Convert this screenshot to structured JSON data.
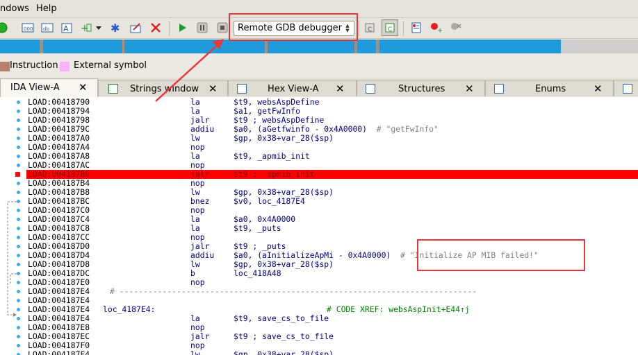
{
  "menu": {
    "items": [
      "ndows",
      "Help"
    ]
  },
  "toolbar": {
    "debugger_select": "Remote GDB debugger",
    "icons": [
      "green-circle-icon",
      "code-icon",
      "data-icon",
      "string-icon",
      "struct-plus-icon",
      "dropdown-arrow-icon",
      "enum-icon",
      "patch-icon",
      "stop-red-x-icon",
      "play-icon",
      "pause-icon",
      "stop-icon",
      "attach-icon",
      "step-into-icon",
      "breakpoint-list-icon",
      "add-breakpoint-icon",
      "detach-icon"
    ]
  },
  "legend": [
    {
      "label": "Instruction",
      "color": "#b8806a"
    },
    {
      "label": "External symbol",
      "color": "#ffb0ff"
    }
  ],
  "tabs": [
    {
      "label": "IDA View-A",
      "active": true
    },
    {
      "label": "Strings window",
      "active": false
    },
    {
      "label": "Hex View-A",
      "active": false
    },
    {
      "label": "Structures",
      "active": false
    },
    {
      "label": "Enums",
      "active": false
    }
  ],
  "disasm": [
    {
      "addr": "LOAD:00418790",
      "mn": "la",
      "op": "$t9, websAspDefine",
      "comment": ""
    },
    {
      "addr": "LOAD:00418794",
      "mn": "la",
      "op": "$a1, getFwInfo",
      "comment": ""
    },
    {
      "addr": "LOAD:00418798",
      "mn": "jalr",
      "op": "$t9 ; websAspDefine",
      "comment": ""
    },
    {
      "addr": "LOAD:0041879C",
      "mn": "addiu",
      "op": "$a0, (aGetfwinfo - 0x4A0000)",
      "comment": "# \"getFwInfo\""
    },
    {
      "addr": "LOAD:004187A0",
      "mn": "lw",
      "op": "$gp, 0x38+var_28($sp)",
      "comment": ""
    },
    {
      "addr": "LOAD:004187A4",
      "mn": "nop",
      "op": "",
      "comment": ""
    },
    {
      "addr": "LOAD:004187A8",
      "mn": "la",
      "op": "$t9, _apmib_init",
      "comment": ""
    },
    {
      "addr": "LOAD:004187AC",
      "mn": "nop",
      "op": "",
      "comment": ""
    },
    {
      "addr": "LOAD:004187B0",
      "mn": "jalr",
      "op": "$t9 ; _apmib_init",
      "comment": "",
      "highlight": true
    },
    {
      "addr": "LOAD:004187B4",
      "mn": "nop",
      "op": "",
      "comment": ""
    },
    {
      "addr": "LOAD:004187B8",
      "mn": "lw",
      "op": "$gp, 0x38+var_28($sp)",
      "comment": ""
    },
    {
      "addr": "LOAD:004187BC",
      "mn": "bnez",
      "op": "$v0, loc_4187E4",
      "comment": ""
    },
    {
      "addr": "LOAD:004187C0",
      "mn": "nop",
      "op": "",
      "comment": ""
    },
    {
      "addr": "LOAD:004187C4",
      "mn": "la",
      "op": "$a0, 0x4A0000",
      "comment": ""
    },
    {
      "addr": "LOAD:004187C8",
      "mn": "la",
      "op": "$t9, _puts",
      "comment": ""
    },
    {
      "addr": "LOAD:004187CC",
      "mn": "nop",
      "op": "",
      "comment": ""
    },
    {
      "addr": "LOAD:004187D0",
      "mn": "jalr",
      "op": "$t9 ; _puts",
      "comment": ""
    },
    {
      "addr": "LOAD:004187D4",
      "mn": "addiu",
      "op": "$a0, (aInitializeApMi - 0x4A0000)",
      "comment": "# \"Initialize AP MIB failed!\""
    },
    {
      "addr": "LOAD:004187D8",
      "mn": "lw",
      "op": "$gp, 0x38+var_28($sp)",
      "comment": ""
    },
    {
      "addr": "LOAD:004187DC",
      "mn": "b",
      "op": "loc_418A48",
      "comment": ""
    },
    {
      "addr": "LOAD:004187E0",
      "mn": "nop",
      "op": "",
      "comment": ""
    },
    {
      "addr": "LOAD:004187E4",
      "separator": "# ---------------------------------------------------------------------------"
    },
    {
      "addr": "LOAD:004187E4",
      "mn": "",
      "op": "",
      "comment": ""
    },
    {
      "addr": "LOAD:004187E4",
      "label": "loc_4187E4:",
      "xref": "# CODE XREF: websAspInit+E44↑j"
    },
    {
      "addr": "LOAD:004187E4",
      "mn": "la",
      "op": "$t9, save_cs_to_file",
      "comment": ""
    },
    {
      "addr": "LOAD:004187E8",
      "mn": "nop",
      "op": "",
      "comment": ""
    },
    {
      "addr": "LOAD:004187EC",
      "mn": "jalr",
      "op": "$t9 ; save_cs_to_file",
      "comment": ""
    },
    {
      "addr": "LOAD:004187F0",
      "mn": "nop",
      "op": "",
      "comment": ""
    },
    {
      "addr": "LOAD:004187F4",
      "mn": "lw",
      "op": "$gp, 0x38+var_28($sp)",
      "comment": ""
    }
  ]
}
